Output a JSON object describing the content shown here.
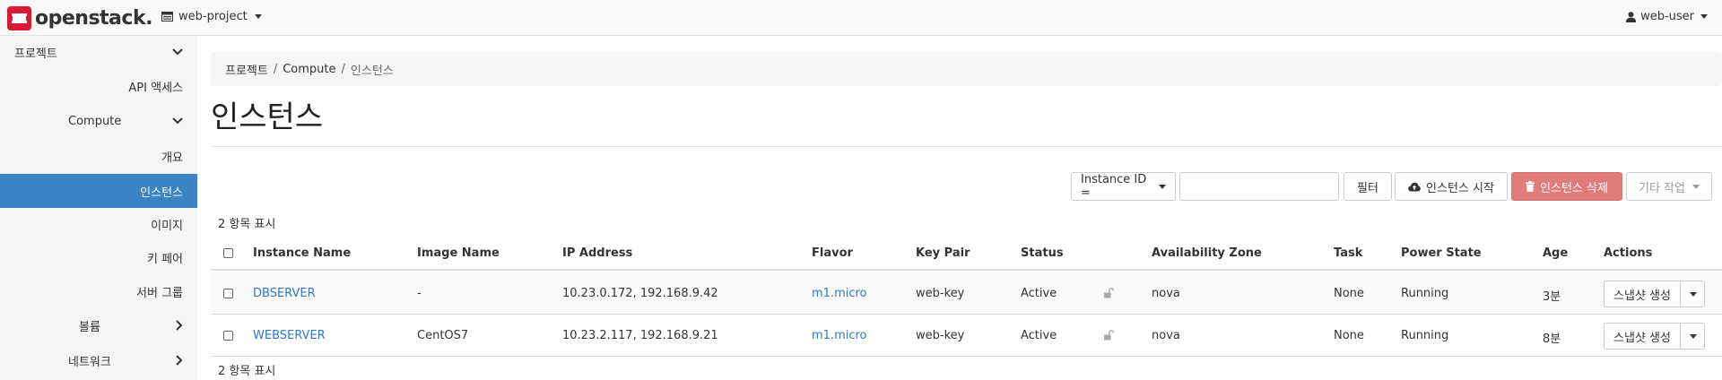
{
  "header": {
    "logo_text": "openstack.",
    "project": "web-project",
    "user": "web-user"
  },
  "sidebar": {
    "items": [
      {
        "label": "프로젝트"
      },
      {
        "label": "API 액세스"
      },
      {
        "label": "Compute"
      },
      {
        "label": "개요"
      },
      {
        "label": "인스턴스"
      },
      {
        "label": "이미지"
      },
      {
        "label": "키 페어"
      },
      {
        "label": "서버 그룹"
      },
      {
        "label": "볼륨"
      },
      {
        "label": "네트워크"
      }
    ]
  },
  "breadcrumb": {
    "items": [
      "프로젝트",
      "Compute",
      "인스턴스"
    ],
    "separator": "/"
  },
  "page": {
    "title": "인스턴스"
  },
  "toolbar": {
    "filter_field": "Instance ID =",
    "search_value": "",
    "filter_button": "필터",
    "launch_button": "인스턴스 시작",
    "delete_button": "인스턴스 삭제",
    "more_actions_button": "기타 작업"
  },
  "summary": {
    "top": "2 항목 표시",
    "bottom": "2 항목 표시"
  },
  "table": {
    "columns": [
      "Instance Name",
      "Image Name",
      "IP Address",
      "Flavor",
      "Key Pair",
      "Status",
      "Availability Zone",
      "Task",
      "Power State",
      "Age",
      "Actions"
    ],
    "rows": [
      {
        "name": "DBSERVER",
        "image": "-",
        "ip": "10.23.0.172, 192.168.9.42",
        "flavor": "m1.micro",
        "keypair": "web-key",
        "status": "Active",
        "zone": "nova",
        "task": "None",
        "power": "Running",
        "age": "3분",
        "action": "스냅샷 생성"
      },
      {
        "name": "WEBSERVER",
        "image": "CentOS7",
        "ip": "10.23.2.117, 192.168.9.21",
        "flavor": "m1.micro",
        "keypair": "web-key",
        "status": "Active",
        "zone": "nova",
        "task": "None",
        "power": "Running",
        "age": "8분",
        "action": "스냅샷 생성"
      }
    ]
  },
  "colors": {
    "brand_red": "#da1a32",
    "active_nav": "#3b84c4",
    "link": "#2d79c7",
    "danger": "#e07b78"
  }
}
